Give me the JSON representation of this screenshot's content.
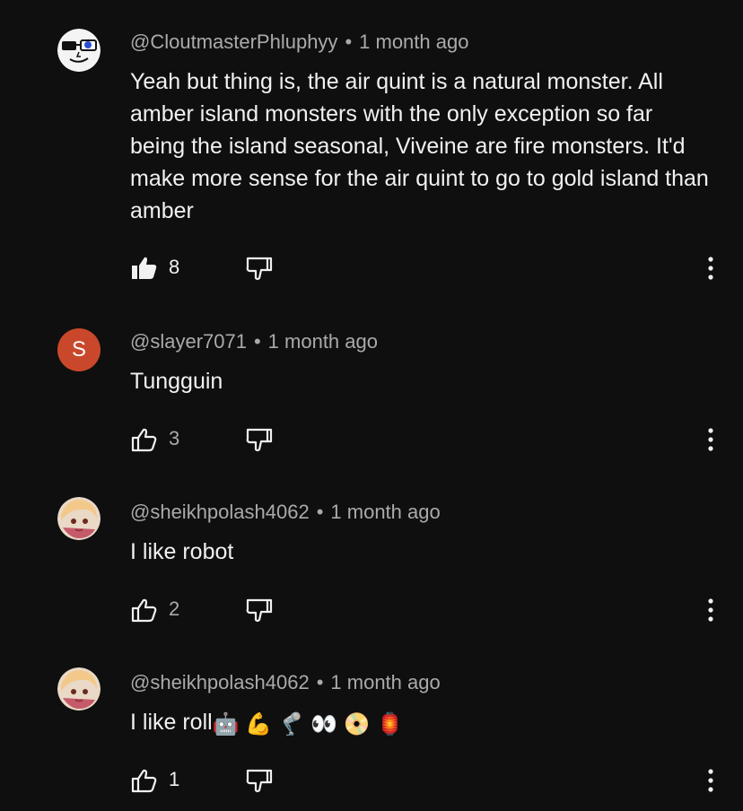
{
  "comments": [
    {
      "author": "@CloutmasterPhluphyy",
      "separator": "•",
      "time": "1 month ago",
      "text": "Yeah but thing is, the air quint is a natural monster. All amber island monsters with the only exception so far being the island seasonal, Viveine are fire monsters. It'd make more sense for the air quint to go to gold island than amber",
      "likes": "8",
      "liked": true,
      "avatar_type": "drawing"
    },
    {
      "author": "@slayer7071",
      "separator": "•",
      "time": "1 month ago",
      "text": "Tungguin",
      "likes": "3",
      "liked": false,
      "avatar_letter": "S",
      "avatar_color": "#c9482b"
    },
    {
      "author": "@sheikhpolash4062",
      "separator": "•",
      "time": "1 month ago",
      "text": "I like robot",
      "likes": "2",
      "liked": false,
      "avatar_type": "anime"
    },
    {
      "author": "@sheikhpolash4062",
      "separator": "•",
      "time": "1 month ago",
      "text": "I like roll",
      "emojis": "🤖 💪 🦿 👀 📀 🏮",
      "likes": "1",
      "liked": false,
      "avatar_type": "anime"
    }
  ],
  "icons": {
    "like": "thumbs-up-icon",
    "dislike": "thumbs-down-icon",
    "more": "more-vertical-icon"
  },
  "colors": {
    "background": "#0f0f0f",
    "text": "#f1f1f1",
    "secondary": "#aaaaaa",
    "avatar_s": "#c9482b"
  }
}
